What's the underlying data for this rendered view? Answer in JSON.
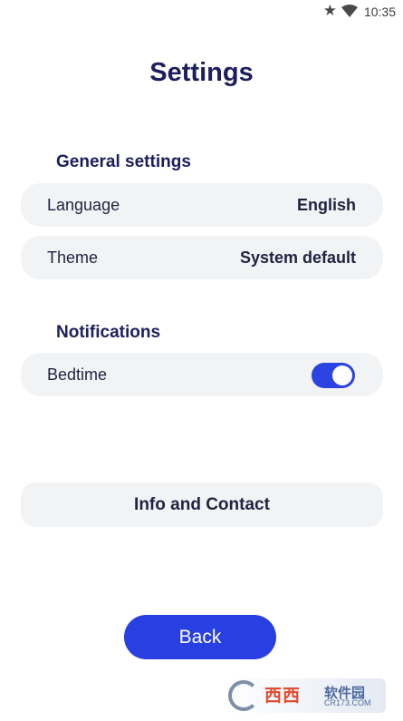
{
  "status_bar": {
    "star_icon": "star-icon",
    "wifi_icon": "wifi-icon",
    "time": "10:35"
  },
  "page": {
    "title": "Settings"
  },
  "general": {
    "section_title": "General settings",
    "language_label": "Language",
    "language_value": "English",
    "theme_label": "Theme",
    "theme_value": "System default"
  },
  "notifications": {
    "section_title": "Notifications",
    "bedtime_label": "Bedtime",
    "bedtime_enabled": true
  },
  "info_button": "Info and Contact",
  "back_button": "Back",
  "watermark": {
    "text": "西西",
    "sub": "软件园",
    "url": "CR173.COM"
  },
  "colors": {
    "accent": "#2840e2",
    "title": "#1c1f5c",
    "row_bg": "#f2f3f5"
  }
}
